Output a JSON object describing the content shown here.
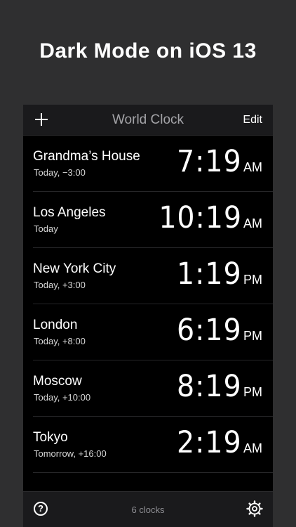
{
  "headline": "Dark Mode on iOS 13",
  "navbar": {
    "title": "World Clock",
    "edit_label": "Edit",
    "add_icon": "plus-icon"
  },
  "clocks": [
    {
      "city": "Grandma’s House",
      "offset": "Today, −3:00",
      "time": "7:19",
      "ampm": "AM"
    },
    {
      "city": "Los Angeles",
      "offset": "Today",
      "time": "10:19",
      "ampm": "AM"
    },
    {
      "city": "New York City",
      "offset": "Today, +3:00",
      "time": "1:19",
      "ampm": "PM"
    },
    {
      "city": "London",
      "offset": "Today, +8:00",
      "time": "6:19",
      "ampm": "PM"
    },
    {
      "city": "Moscow",
      "offset": "Today, +10:00",
      "time": "8:19",
      "ampm": "PM"
    },
    {
      "city": "Tokyo",
      "offset": "Tomorrow, +16:00",
      "time": "2:19",
      "ampm": "AM"
    }
  ],
  "toolbar": {
    "help_symbol": "?",
    "count_label": "6 clocks",
    "settings_icon": "gear-icon"
  },
  "colors": {
    "background": "#2f2f30",
    "screen": "#000000",
    "bars": "#1a1a1c",
    "title_gray": "#a3a3a7"
  }
}
